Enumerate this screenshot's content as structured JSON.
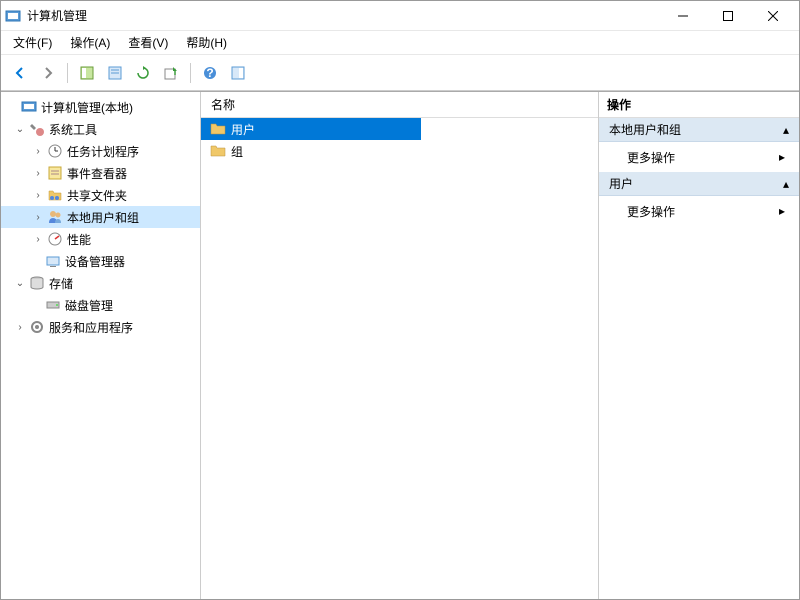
{
  "window": {
    "title": "计算机管理"
  },
  "menu": {
    "file": "文件(F)",
    "action": "操作(A)",
    "view": "查看(V)",
    "help": "帮助(H)"
  },
  "tree": {
    "root": "计算机管理(本地)",
    "systemTools": "系统工具",
    "taskScheduler": "任务计划程序",
    "eventViewer": "事件查看器",
    "sharedFolders": "共享文件夹",
    "localUsersGroups": "本地用户和组",
    "performance": "性能",
    "deviceManager": "设备管理器",
    "storage": "存储",
    "diskManagement": "磁盘管理",
    "servicesApps": "服务和应用程序"
  },
  "list": {
    "columnName": "名称",
    "users": "用户",
    "groups": "组"
  },
  "actions": {
    "header": "操作",
    "section1": "本地用户和组",
    "more1": "更多操作",
    "section2": "用户",
    "more2": "更多操作"
  }
}
